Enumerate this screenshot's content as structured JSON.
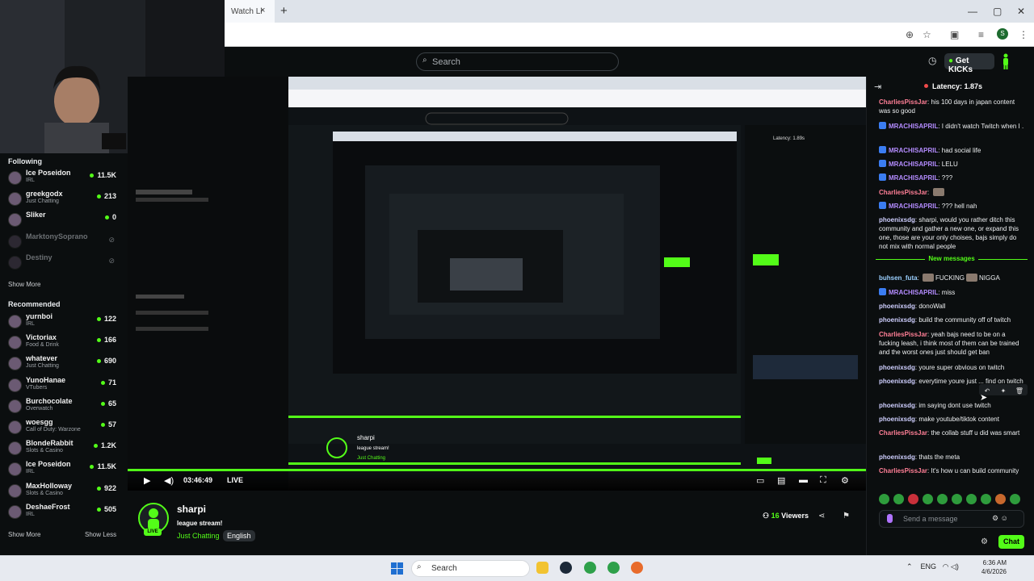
{
  "browser": {
    "tab_title": "Watch Li",
    "tab_close": "×",
    "new_tab": "+",
    "window": {
      "minimize": "—",
      "maximize": "▢",
      "close": "✕"
    },
    "toolbar_icons": [
      "zoom-icon",
      "star-icon",
      "extensions-icon",
      "queue-icon",
      "profile-avatar",
      "menu-icon"
    ],
    "profile_initial": "S"
  },
  "header": {
    "search_placeholder": "Search",
    "get_kicks": "Get KICKs"
  },
  "sidebar": {
    "following_title": "Following",
    "following": [
      {
        "name": "Ice Poseidon",
        "category": "IRL",
        "viewers": "11.5K",
        "online": true
      },
      {
        "name": "greekgodx",
        "category": "Just Chatting",
        "viewers": "213",
        "online": true
      },
      {
        "name": "Sliker",
        "category": "",
        "viewers": "0",
        "online": true
      },
      {
        "name": "MarktonySoprano",
        "category": "",
        "viewers": "",
        "online": false
      },
      {
        "name": "Destiny",
        "category": "",
        "viewers": "",
        "online": false
      }
    ],
    "show_more_1": "Show More",
    "recommended_title": "Recommended",
    "recommended": [
      {
        "name": "yurnboi",
        "category": "IRL",
        "viewers": "122"
      },
      {
        "name": "Victoriax",
        "category": "Food & Drink",
        "viewers": "166"
      },
      {
        "name": "whatever",
        "category": "Just Chatting",
        "viewers": "690"
      },
      {
        "name": "YunoHanae",
        "category": "VTubers",
        "viewers": "71"
      },
      {
        "name": "Burchocolate",
        "category": "Overwatch",
        "viewers": "65"
      },
      {
        "name": "woesgg",
        "category": "Call of Duty: Warzone",
        "viewers": "57"
      },
      {
        "name": "BlondeRabbit",
        "category": "Slots & Casino",
        "viewers": "1.2K"
      },
      {
        "name": "Ice Poseidon",
        "category": "IRL",
        "viewers": "11.5K"
      },
      {
        "name": "MaxHolloway",
        "category": "Slots & Casino",
        "viewers": "922"
      },
      {
        "name": "DeshaeFrost",
        "category": "IRL",
        "viewers": "505"
      }
    ],
    "show_more_2": "Show More",
    "show_less": "Show Less"
  },
  "player": {
    "time": "03:46:49",
    "live": "LIVE",
    "progress": 1.0
  },
  "stream": {
    "streamer": "sharpi",
    "title": "league stream!",
    "category": "Just Chatting",
    "language": "English",
    "live_badge": "LIVE",
    "viewer_count": "16",
    "viewers_label": "Viewers"
  },
  "chat": {
    "latency": "Latency: 1.87s",
    "messages": [
      {
        "user": "CharliesPissJar",
        "cls": "u-cpj",
        "badge": false,
        "text": "his 100 days in japan content was so good"
      },
      {
        "user": "MRACHISAPRIL",
        "cls": "u-mra",
        "badge": true,
        "text": "I didn't watch Twitch when I ."
      },
      {
        "user": "MRACHISAPRIL",
        "cls": "u-mra",
        "badge": true,
        "text": "had social life"
      },
      {
        "user": "MRACHISAPRIL",
        "cls": "u-mra",
        "badge": true,
        "text": "LELU"
      },
      {
        "user": "MRACHISAPRIL",
        "cls": "u-mra",
        "badge": true,
        "text": "???"
      },
      {
        "user": "CharliesPissJar",
        "cls": "u-cpj",
        "badge": false,
        "text": "",
        "emote": true
      },
      {
        "user": "MRACHISAPRIL",
        "cls": "u-mra",
        "badge": true,
        "text": "??? hell nah"
      },
      {
        "user": "phoenixsdg",
        "cls": "u-phx",
        "badge": false,
        "text": "sharpi, would you rather ditch this community and gather a new one, or expand this one, those are your only choises, bajs simply do not mix with normal people"
      }
    ],
    "new_messages": "New messages",
    "new": [
      {
        "user": "buhsen_futa",
        "cls": "u-buh",
        "badge": false,
        "text": "FUCKING",
        "text2": "NIGGA",
        "emote": true
      },
      {
        "user": "MRACHISAPRIL",
        "cls": "u-mra",
        "badge": true,
        "text": "miss"
      },
      {
        "user": "phoenixsdg",
        "cls": "u-phx",
        "badge": false,
        "text": "donoWall"
      },
      {
        "user": "phoenixsdg",
        "cls": "u-phx",
        "badge": false,
        "text": "build the community off of twitch"
      },
      {
        "user": "CharliesPissJar",
        "cls": "u-cpj",
        "badge": false,
        "text": "yeah bajs need to be on a fucking leash, i think most of them can be trained and the worst ones just should get ban"
      },
      {
        "user": "phoenixsdg",
        "cls": "u-phx",
        "badge": false,
        "text": "youre super obvious on twitch"
      },
      {
        "user": "phoenixsdg",
        "cls": "u-phx",
        "badge": false,
        "text": "everytime youre just ... find on twitch"
      },
      {
        "user": "phoenixsdg",
        "cls": "u-phx",
        "badge": false,
        "text": "im saying dont use twitch"
      },
      {
        "user": "phoenixsdg",
        "cls": "u-phx",
        "badge": false,
        "text": "make youtube/tiktok content"
      },
      {
        "user": "CharliesPissJar",
        "cls": "u-cpj",
        "badge": false,
        "text": "the collab stuff u did was smart"
      },
      {
        "user": "phoenixsdg",
        "cls": "u-phx",
        "badge": false,
        "text": "thats the meta"
      },
      {
        "user": "CharliesPissJar",
        "cls": "u-cpj",
        "badge": false,
        "text": "It's how u can build community"
      }
    ],
    "input_placeholder": "Send a message",
    "send": "Chat"
  },
  "taskbar": {
    "search": "Search",
    "lang": "ENG",
    "time": "6:36 AM",
    "date": "4/6/2026"
  },
  "colors": {
    "accent": "#53fc18",
    "bg": "#0b0e0f"
  }
}
